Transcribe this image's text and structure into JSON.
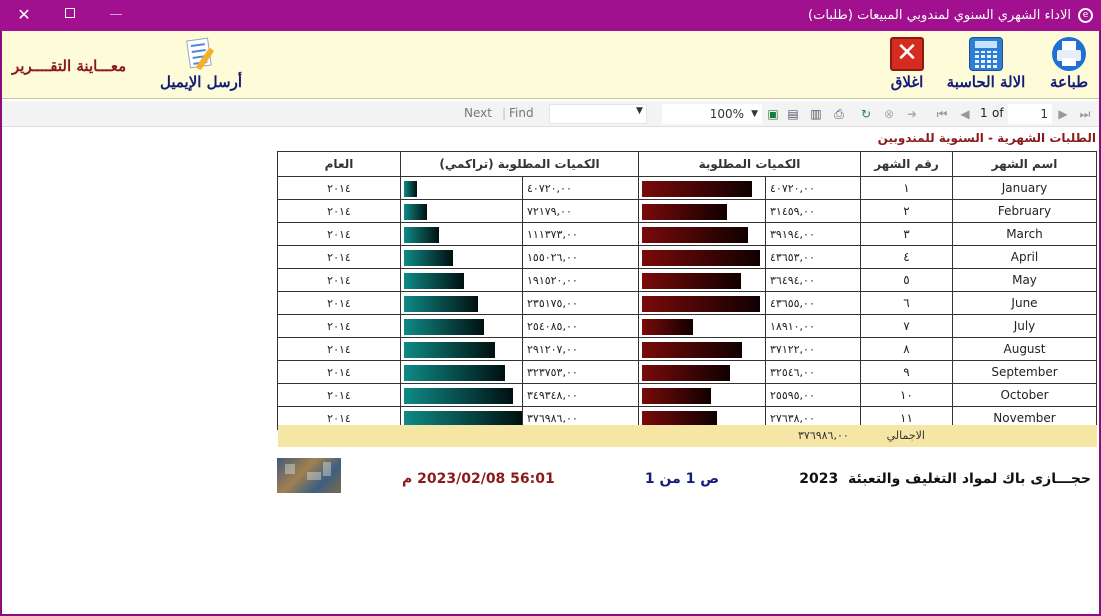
{
  "window": {
    "title": "الاداء الشهري السنوي لمندوبي المبيعات (طلبات)",
    "buttons": {
      "close": "✕",
      "minimize": "—"
    }
  },
  "ribbon": {
    "print_label": "طباعة",
    "calc_label": "الالة الحاسبة",
    "close_label": "اغلاق",
    "email_label": "أرسل الإيميل",
    "preview_title": "معـــاينة التقــــرير"
  },
  "toolbar": {
    "next": "Next",
    "separator": "|",
    "find": "Find",
    "zoom": "100%",
    "page_current": "1",
    "page_of": "of",
    "page_input": "1"
  },
  "report": {
    "title": "الطلبات الشهرية - السنوية للمندوبين",
    "headers": {
      "month_name": "اسم الشهر",
      "month_no": "رقم الشهر",
      "qty": "الكميات المطلوبة",
      "qty_cum": "الكميات المطلوبة (تراكمي)",
      "year": "العام"
    },
    "rows": [
      {
        "month": "January",
        "no": "١",
        "qty": "٤٠٧٢٠,٠٠",
        "qty_v": 40720,
        "cum": "٤٠٧٢٠,٠٠",
        "cum_v": 40720,
        "year": "٢٠١٤"
      },
      {
        "month": "February",
        "no": "٢",
        "qty": "٣١٤٥٩,٠٠",
        "qty_v": 31459,
        "cum": "٧٢١٧٩,٠٠",
        "cum_v": 72179,
        "year": "٢٠١٤"
      },
      {
        "month": "March",
        "no": "٣",
        "qty": "٣٩١٩٤,٠٠",
        "qty_v": 39194,
        "cum": "١١١٣٧٣,٠٠",
        "cum_v": 111373,
        "year": "٢٠١٤"
      },
      {
        "month": "April",
        "no": "٤",
        "qty": "٤٣٦٥٣,٠٠",
        "qty_v": 43653,
        "cum": "١٥٥٠٢٦,٠٠",
        "cum_v": 155026,
        "year": "٢٠١٤"
      },
      {
        "month": "May",
        "no": "٥",
        "qty": "٣٦٤٩٤,٠٠",
        "qty_v": 36494,
        "cum": "١٩١٥٢٠,٠٠",
        "cum_v": 191520,
        "year": "٢٠١٤"
      },
      {
        "month": "June",
        "no": "٦",
        "qty": "٤٣٦٥٥,٠٠",
        "qty_v": 43655,
        "cum": "٢٣٥١٧٥,٠٠",
        "cum_v": 235175,
        "year": "٢٠١٤"
      },
      {
        "month": "July",
        "no": "٧",
        "qty": "١٨٩١٠,٠٠",
        "qty_v": 18910,
        "cum": "٢٥٤٠٨٥,٠٠",
        "cum_v": 254085,
        "year": "٢٠١٤"
      },
      {
        "month": "August",
        "no": "٨",
        "qty": "٣٧١٢٢,٠٠",
        "qty_v": 37122,
        "cum": "٢٩١٢٠٧,٠٠",
        "cum_v": 291207,
        "year": "٢٠١٤"
      },
      {
        "month": "September",
        "no": "٩",
        "qty": "٣٢٥٤٦,٠٠",
        "qty_v": 32546,
        "cum": "٣٢٣٧٥٣,٠٠",
        "cum_v": 323753,
        "year": "٢٠١٤"
      },
      {
        "month": "October",
        "no": "١٠",
        "qty": "٢٥٥٩٥,٠٠",
        "qty_v": 25595,
        "cum": "٣٤٩٣٤٨,٠٠",
        "cum_v": 349348,
        "year": "٢٠١٤"
      },
      {
        "month": "November",
        "no": "١١",
        "qty": "٢٧٦٣٨,٠٠",
        "qty_v": 27638,
        "cum": "٣٧٦٩٨٦,٠٠",
        "cum_v": 376986,
        "year": "٢٠١٤"
      }
    ],
    "totals": {
      "label": "الاجمالي",
      "value": "٣٧٦٩٨٦,٠٠"
    }
  },
  "footer": {
    "company": "حجـــازى باك لمواد التغليف والتعبئة",
    "year": "2023",
    "page": "ص 1 من 1",
    "datetime": "56:01 2023/02/08 م"
  },
  "colors": {
    "titlebar": "#a0108f",
    "ribbon": "#fdfbd8",
    "totals": "#f6e6a6",
    "qty_bar": "#7a0a0a",
    "cum_bar": "#0f8a86"
  }
}
